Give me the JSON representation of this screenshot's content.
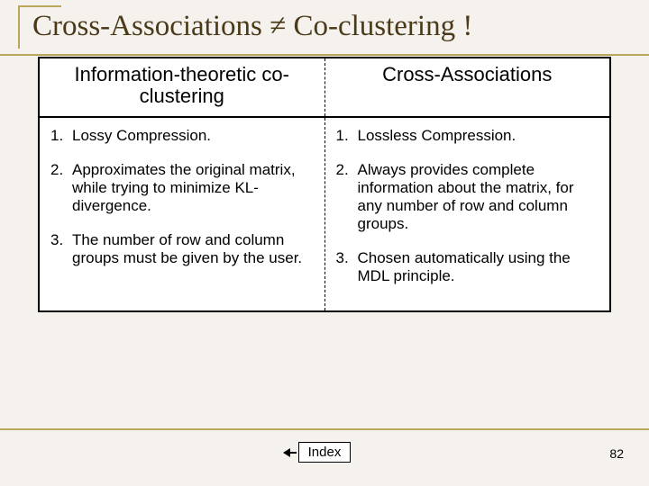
{
  "title": "Cross-Associations ≠ Co-clustering !",
  "headers": {
    "left": "Information-theoretic  co-clustering",
    "right": "Cross-Associations"
  },
  "left_items": [
    {
      "n": "1.",
      "t": "Lossy Compression."
    },
    {
      "n": "2.",
      "t": "Approximates the original matrix, while trying to minimize KL-divergence."
    },
    {
      "n": "3.",
      "t": "The number of row and column groups must be given by the user."
    }
  ],
  "right_items": [
    {
      "n": "1.",
      "t": "Lossless Compression."
    },
    {
      "n": "2.",
      "t": "Always provides complete information about the matrix, for any number of row and column groups."
    },
    {
      "n": "3.",
      "t": "Chosen automatically using the MDL principle."
    }
  ],
  "index_label": "Index",
  "page_number": "82"
}
